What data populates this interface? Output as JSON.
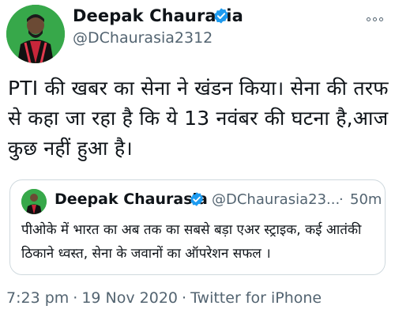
{
  "author": {
    "display_name": "Deepak Chaurasia",
    "handle": "@DChaurasia2312",
    "avatar_icon": "profile-photo",
    "verified_icon": "verified-badge-icon"
  },
  "tweet": {
    "text": "PTI की खबर का सेना ने खंडन किया। सेना की तरफ से कहा जा रहा है कि ये 13 नवंबर की घटना है,आज कुछ नहीं हुआ है।"
  },
  "quote": {
    "display_name": "Deepak Chaurasia",
    "handle": "@DChaurasia23...",
    "dot": "·",
    "time": "50m",
    "text": "पीओके में भारत का अब तक का सबसे बड़ा एअर स्ट्राइक, कई आतंकी ठिकाने ध्वस्त,  सेना के जवानों का ऑपरेशन सफल ।"
  },
  "meta": {
    "time": "7:23 pm",
    "sep1": "·",
    "date": "19 Nov 2020",
    "sep2": "·",
    "source": "Twitter for iPhone"
  },
  "colors": {
    "verified": "#1d9bf0",
    "secondary_text": "#536471",
    "border": "#cfd9de"
  }
}
